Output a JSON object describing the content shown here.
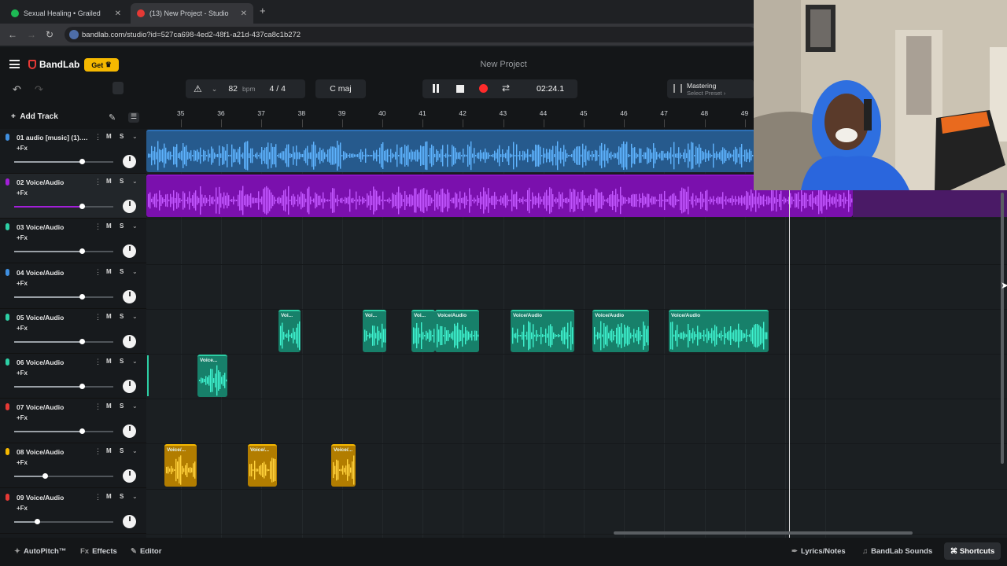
{
  "browser": {
    "tabs": [
      {
        "title": "Sexual Healing • Grailed",
        "favicon_color": "#1db954"
      },
      {
        "title": "(13) New Project - Studio",
        "favicon_color": "#e53935"
      }
    ],
    "url": "bandlab.com/studio?id=527ca698-4ed2-48f1-a21d-437ca8c1b272"
  },
  "app": {
    "brand": "BandLab",
    "get_label": "Get",
    "project_title": "New Project",
    "tempo": "82",
    "tempo_unit": "bpm",
    "time_signature": "4 / 4",
    "key": "C maj",
    "time": "02:24.1",
    "mastering_label": "Mastering",
    "mastering_preset": "Select Preset ›",
    "add_track": "Add Track"
  },
  "ruler": {
    "bars": [
      "35",
      "36",
      "37",
      "38",
      "39",
      "40",
      "41",
      "42",
      "43",
      "44",
      "45",
      "46",
      "47",
      "48",
      "49"
    ]
  },
  "tracks": [
    {
      "name": "01 audio [music] (1).m...",
      "fx": "+Fx",
      "color": "#3f8fe0",
      "volume_pct": 68,
      "clip_color": "#2c6fb6",
      "clip_bg": "#265a8d",
      "wave": "#5fb4ff"
    },
    {
      "name": "02 Voice/Audio",
      "fx": "+Fx",
      "color": "#a21fd8",
      "volume_pct": 68,
      "clip_color": "#8e14c8",
      "clip_bg": "#7a10ad",
      "wave": "#c257ff"
    },
    {
      "name": "03 Voice/Audio",
      "fx": "+Fx",
      "color": "#2dcfa5",
      "volume_pct": 68
    },
    {
      "name": "04 Voice/Audio",
      "fx": "+Fx",
      "color": "#3f8fe0",
      "volume_pct": 68
    },
    {
      "name": "05 Voice/Audio",
      "fx": "+Fx",
      "color": "#2dcfa5",
      "volume_pct": 68
    },
    {
      "name": "06 Voice/Audio",
      "fx": "+Fx",
      "color": "#2dcfa5",
      "volume_pct": 68
    },
    {
      "name": "07 Voice/Audio",
      "fx": "+Fx",
      "color": "#e53935",
      "volume_pct": 68
    },
    {
      "name": "08 Voice/Audio",
      "fx": "+Fx",
      "color": "#f5b800",
      "volume_pct": 31
    },
    {
      "name": "09 Voice/Audio",
      "fx": "+Fx",
      "color": "#e53935",
      "volume_pct": 23
    }
  ],
  "clip_labels": {
    "t05": [
      "Voi...",
      "Voi...",
      "Voi...",
      "Voice/Audio",
      "Voice/Audio",
      "Voice/Audio",
      "Voice/Audio"
    ],
    "t06": [
      "Voice..."
    ],
    "t08": [
      "Voice/...",
      "Voice/...",
      "Voice/..."
    ]
  },
  "track_controls": {
    "mute": "M",
    "solo": "S",
    "more": "⋮",
    "expand": "⌄"
  },
  "bottom_bar": {
    "autopitch": "AutoPitch™",
    "effects": "Effects",
    "editor": "Editor",
    "lyrics": "Lyrics/Notes",
    "sounds": "BandLab Sounds",
    "shortcuts": "Shortcuts"
  },
  "colors": {
    "accent_teal": "#2dcfa5",
    "accent_orange": "#f5b800",
    "accent_purple": "#a21fd8",
    "record_red": "#ff2b2b"
  }
}
